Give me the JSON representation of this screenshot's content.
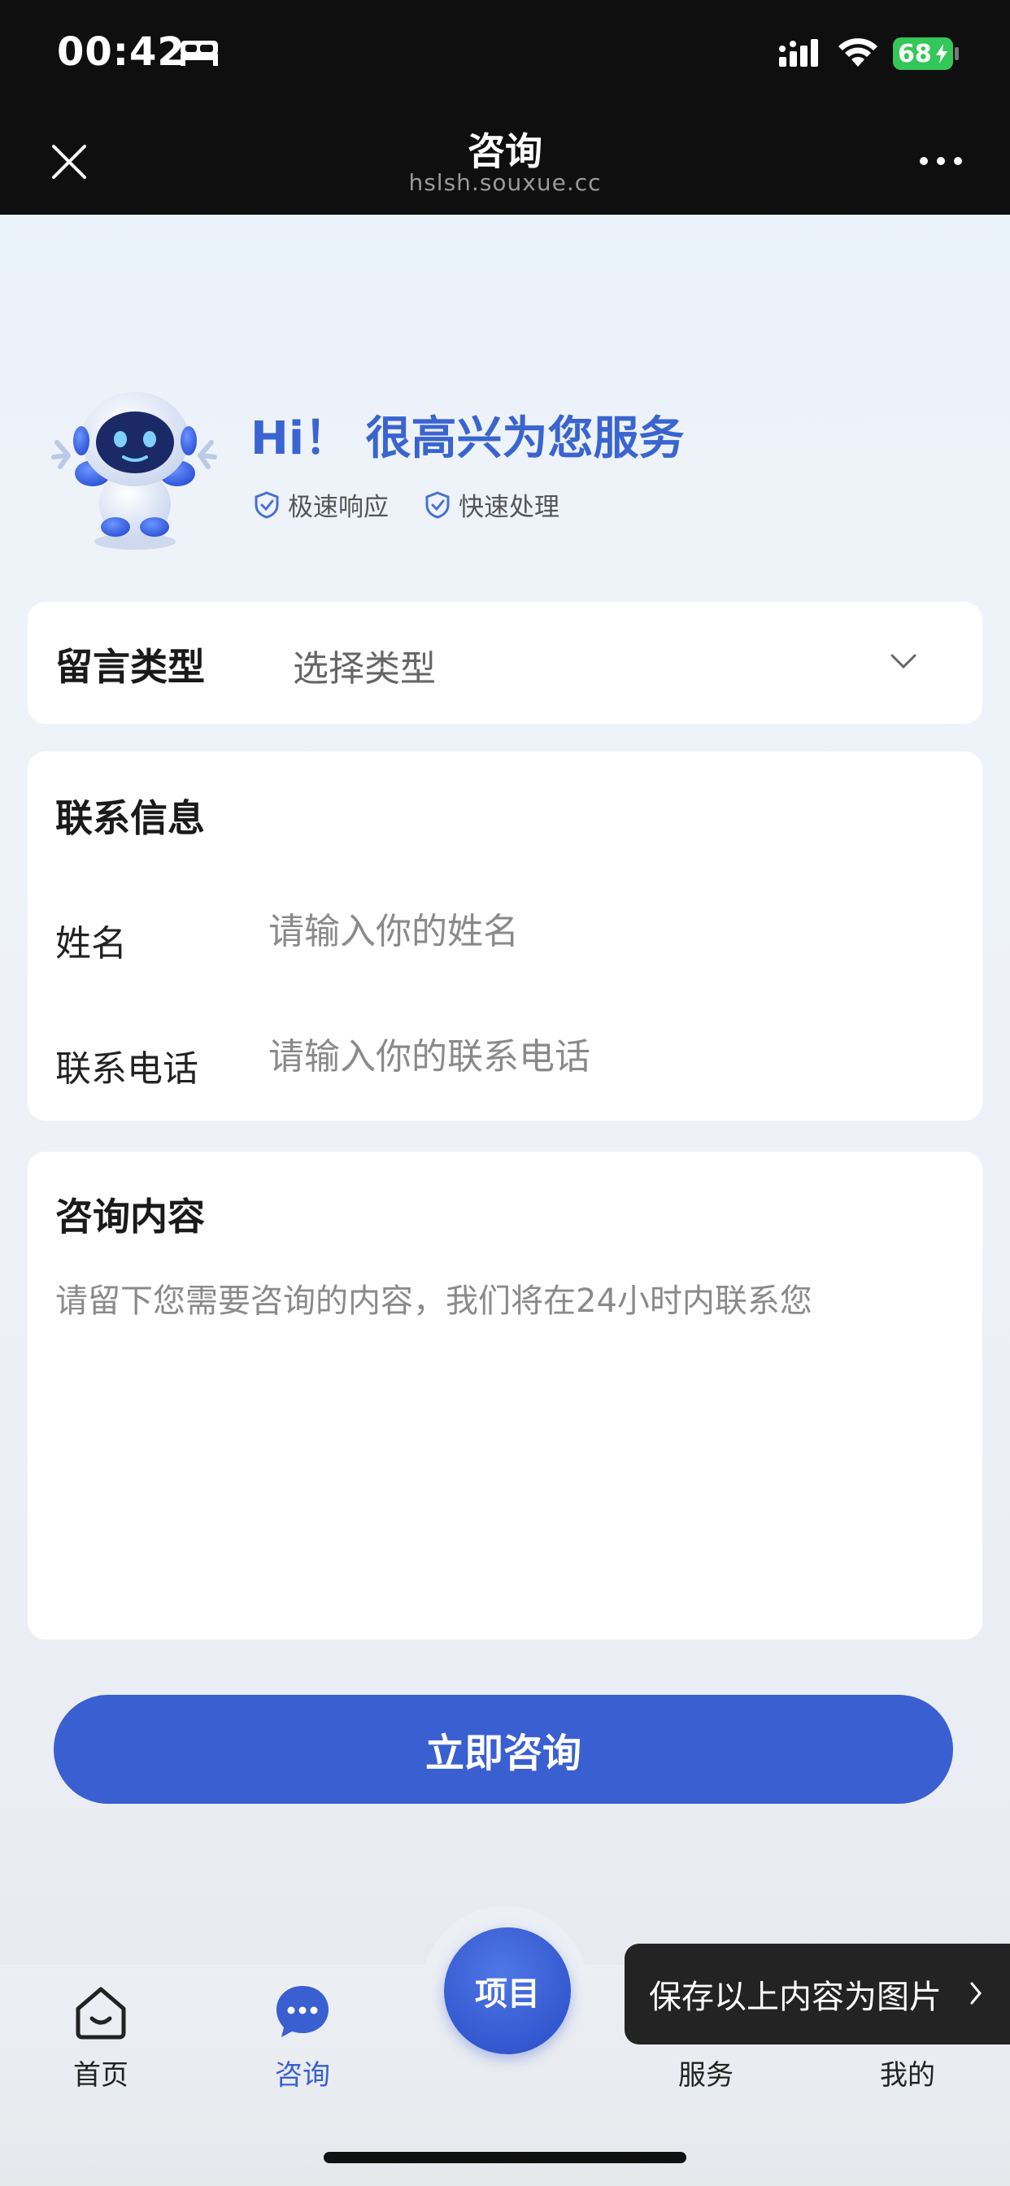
{
  "status_bar": {
    "time": "00:42",
    "battery": "68"
  },
  "nav": {
    "title": "咨询",
    "subtitle": "hslsh.souxue.cc"
  },
  "hero": {
    "greeting": "Hi！ 很高兴为您服务",
    "badges": [
      "极速响应",
      "快速处理"
    ]
  },
  "message_type": {
    "label": "留言类型",
    "select_placeholder": "选择类型"
  },
  "contact": {
    "title": "联系信息",
    "name_label": "姓名",
    "name_placeholder": "请输入你的姓名",
    "phone_label": "联系电话",
    "phone_placeholder": "请输入你的联系电话"
  },
  "content": {
    "title": "咨询内容",
    "placeholder": "请留下您需要咨询的内容，我们将在24小时内联系您"
  },
  "submit_label": "立即咨询",
  "tabbar": {
    "items": [
      {
        "label": "首页",
        "icon": "home-icon"
      },
      {
        "label": "咨询",
        "icon": "chat-icon",
        "active": true
      },
      {
        "label": "项目"
      },
      {
        "label": "服务",
        "icon": "service-icon"
      },
      {
        "label": "我的",
        "icon": "profile-icon"
      }
    ]
  },
  "toast": "保存以上内容为图片",
  "colors": {
    "accent": "#3a5fd1",
    "greeting": "#3a64cf",
    "battery": "#34c759"
  }
}
